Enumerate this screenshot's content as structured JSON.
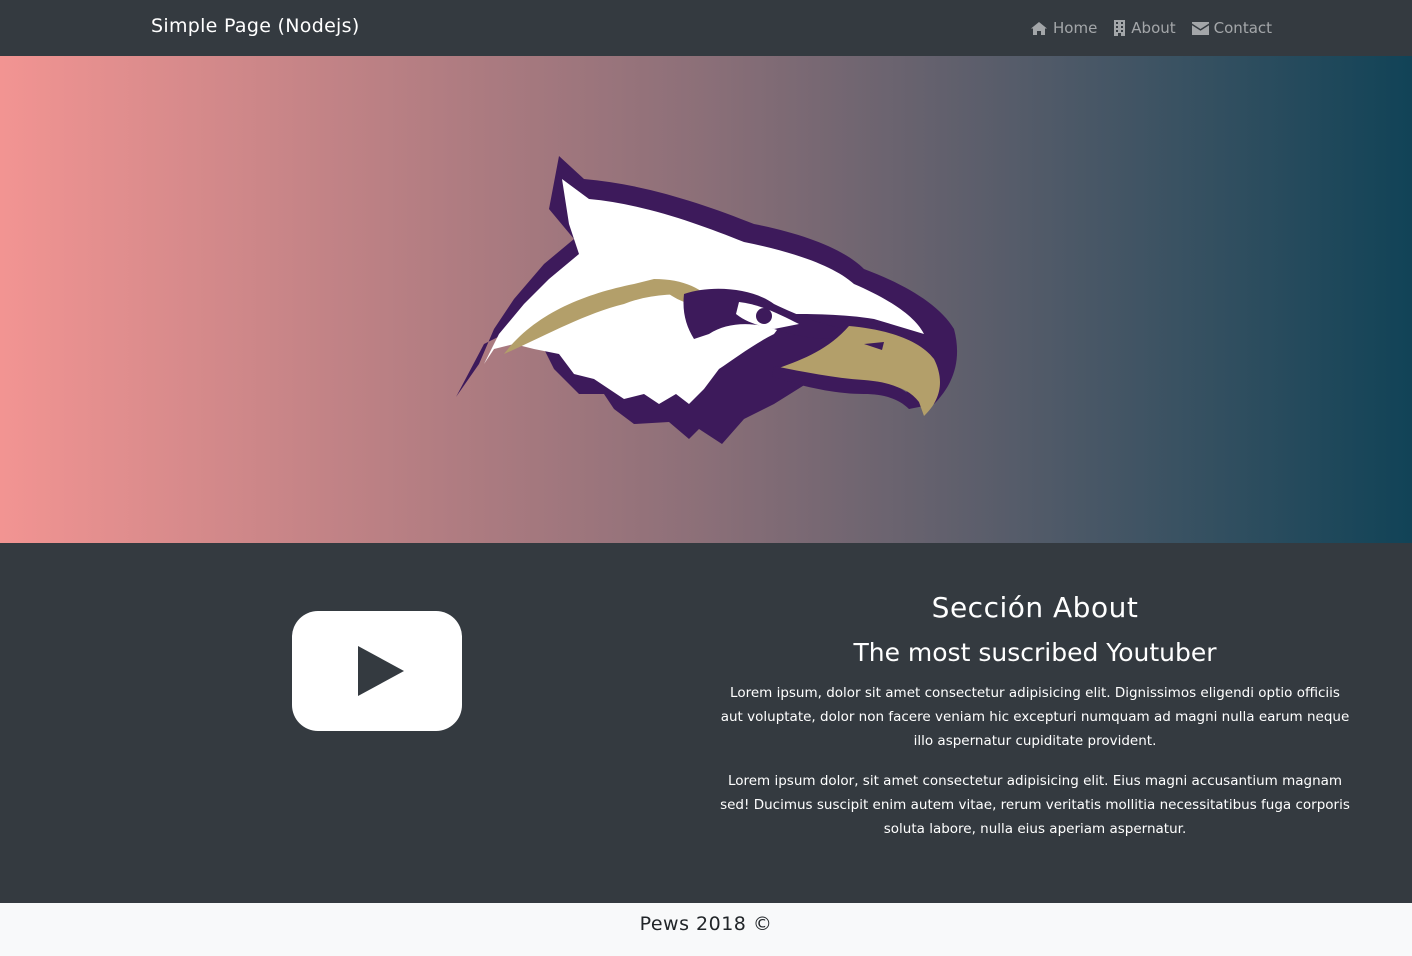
{
  "navbar": {
    "brand": "Simple Page (Nodejs)",
    "links": [
      {
        "label": "Home",
        "icon": "home-icon"
      },
      {
        "label": "About",
        "icon": "building-icon"
      },
      {
        "label": "Contact",
        "icon": "envelope-icon"
      }
    ]
  },
  "hero": {
    "gradient_start": "#f29492",
    "gradient_end": "#114357",
    "logo": "eagle-logo"
  },
  "about": {
    "icon": "youtube-icon",
    "title": "Sección About",
    "subtitle": "The most suscribed Youtuber",
    "paragraphs": [
      "Lorem ipsum, dolor sit amet consectetur adipisicing elit. Dignissimos eligendi optio officiis aut voluptate, dolor non facere veniam hic excepturi numquam ad magni nulla earum neque illo aspernatur cupiditate provident.",
      "Lorem ipsum dolor, sit amet consectetur adipisicing elit. Eius magni accusantium magnam sed! Ducimus suscipit enim autem vitae, rerum veritatis mollitia necessitatibus fuga corporis soluta labore, nulla eius aperiam aspernatur."
    ]
  },
  "footer": {
    "text": "Pews 2018 ©"
  }
}
